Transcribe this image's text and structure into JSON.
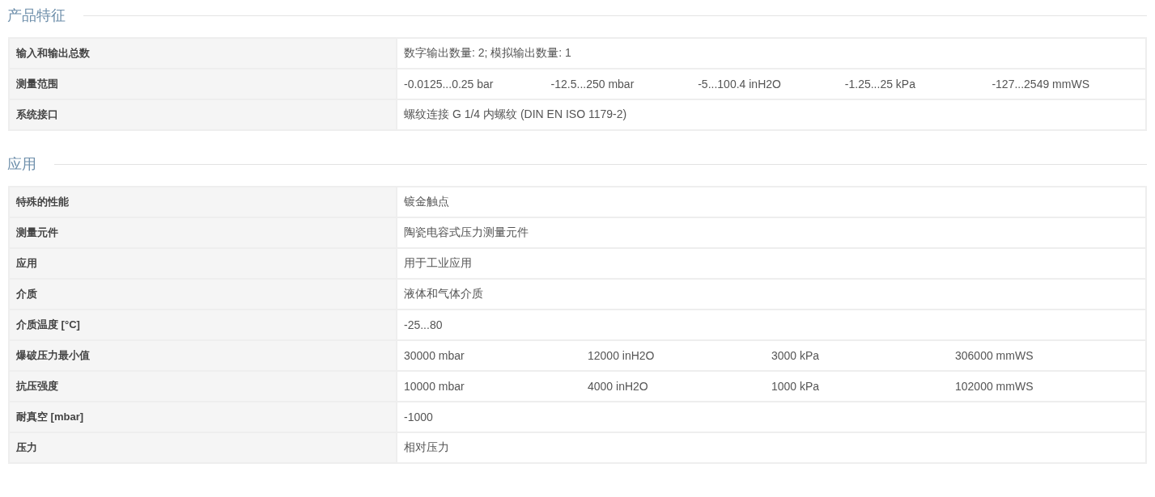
{
  "sections": [
    {
      "title": "产品特征",
      "rows": [
        {
          "label": "输入和输出总数",
          "values": [
            "数字输出数量: 2; 模拟输出数量: 1"
          ]
        },
        {
          "label": "测量范围",
          "values": [
            "-0.0125...0.25 bar",
            "-12.5...250 mbar",
            "-5...100.4 inH2O",
            "-1.25...25 kPa",
            "-127...2549 mmWS"
          ]
        },
        {
          "label": "系统接口",
          "values": [
            "螺纹连接 G 1/4 内螺纹 (DIN EN ISO 1179-2)"
          ]
        }
      ]
    },
    {
      "title": "应用",
      "rows": [
        {
          "label": "特殊的性能",
          "values": [
            "镀金触点"
          ]
        },
        {
          "label": "测量元件",
          "values": [
            "陶瓷电容式压力测量元件"
          ]
        },
        {
          "label": "应用",
          "values": [
            "用于工业应用"
          ]
        },
        {
          "label": "介质",
          "values": [
            "液体和气体介质"
          ]
        },
        {
          "label": "介质温度 [°C]",
          "values": [
            "-25...80"
          ]
        },
        {
          "label": "爆破压力最小值",
          "values": [
            "30000 mbar",
            "12000 inH2O",
            "3000 kPa",
            "306000 mmWS"
          ]
        },
        {
          "label": "抗压强度",
          "values": [
            "10000 mbar",
            "4000 inH2O",
            "1000 kPa",
            "102000 mmWS"
          ]
        },
        {
          "label": "耐真空 [mbar]",
          "values": [
            "-1000"
          ]
        },
        {
          "label": "压力",
          "values": [
            "相对压力"
          ]
        }
      ]
    }
  ]
}
